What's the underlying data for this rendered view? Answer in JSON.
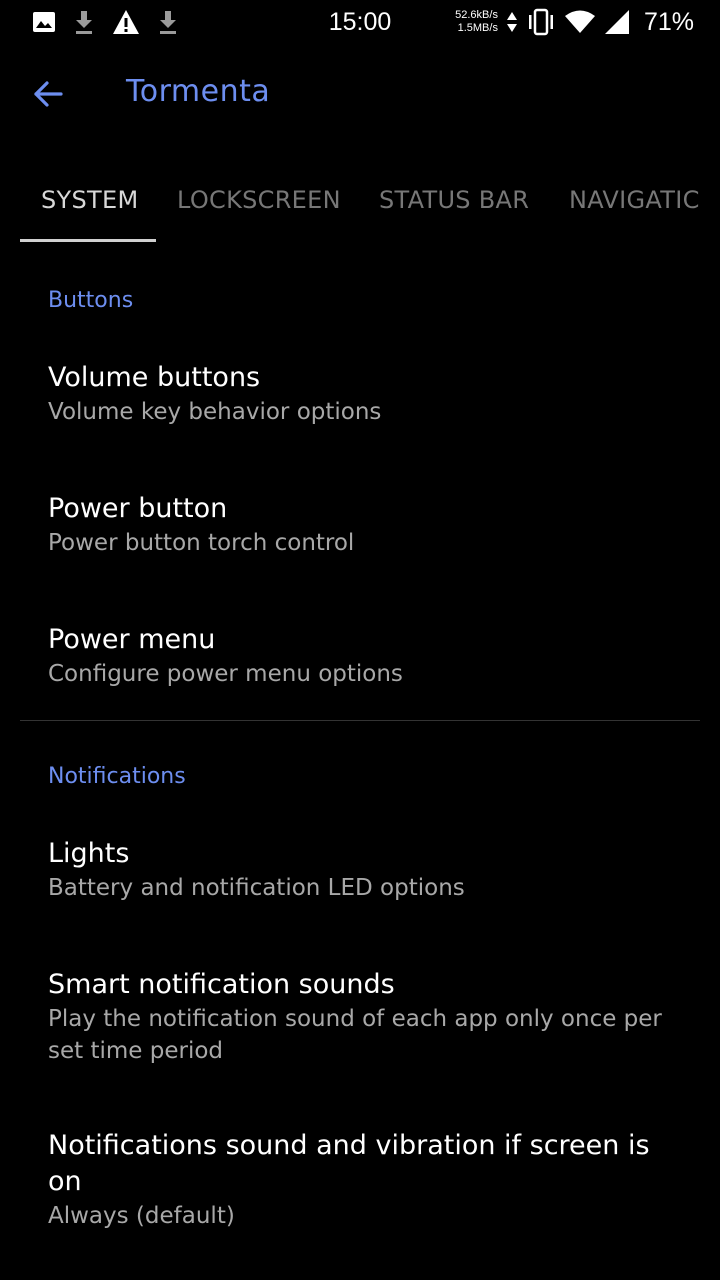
{
  "status_bar": {
    "time": "15:00",
    "net_speed_up": "52.6kB/s",
    "net_speed_down": "1.5MB/s",
    "battery": "71%",
    "left_icons": [
      "image-icon",
      "download-icon",
      "warning-icon",
      "download-icon"
    ],
    "right_icons": [
      "data-arrows-icon",
      "vibrate-icon",
      "wifi-icon",
      "cell-signal-icon"
    ]
  },
  "toolbar": {
    "title": "Tormenta",
    "back_icon": "arrow-back-icon"
  },
  "tabs": [
    {
      "label": "SYSTEM",
      "active": true
    },
    {
      "label": "LOCKSCREEN",
      "active": false
    },
    {
      "label": "STATUS BAR",
      "active": false
    },
    {
      "label": "NAVIGATIC",
      "active": false
    }
  ],
  "sections": {
    "buttons": {
      "header": "Buttons",
      "items": [
        {
          "title": "Volume buttons",
          "summary": "Volume key behavior options"
        },
        {
          "title": "Power button",
          "summary": "Power button torch control"
        },
        {
          "title": "Power menu",
          "summary": "Configure power menu options"
        }
      ]
    },
    "notifications": {
      "header": "Notifications",
      "items": [
        {
          "title": "Lights",
          "summary": "Battery and notification LED options"
        },
        {
          "title": "Smart notification sounds",
          "summary_line1": "Play the notification sound of each app only once per",
          "summary_line2": "set time period"
        },
        {
          "title_line1": "Notifications sound and vibration if screen is",
          "title_line2": "on",
          "summary": "Always (default)"
        }
      ]
    }
  },
  "colors": {
    "accent": "#6d8ef0",
    "background": "#000000",
    "primary_text": "#ffffff",
    "secondary_text": "#a8a8a8",
    "inactive_tab": "#777777"
  }
}
